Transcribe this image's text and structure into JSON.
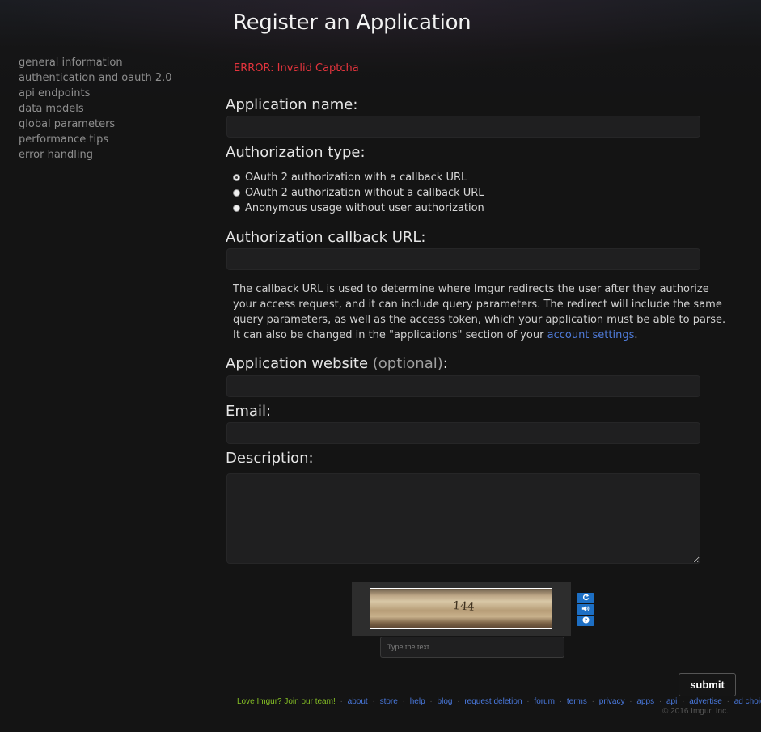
{
  "page": {
    "title": "Register an Application",
    "error": "ERROR: Invalid Captcha"
  },
  "sidebar": {
    "items": [
      {
        "label": "general information"
      },
      {
        "label": "authentication and oauth 2.0"
      },
      {
        "label": "api endpoints"
      },
      {
        "label": "data models"
      },
      {
        "label": "global parameters"
      },
      {
        "label": "performance tips"
      },
      {
        "label": "error handling"
      }
    ]
  },
  "form": {
    "app_name_label": "Application name:",
    "app_name_value": "",
    "auth_type_label": "Authorization type:",
    "auth_options": [
      {
        "label": "OAuth 2 authorization with a callback URL",
        "checked": true
      },
      {
        "label": "OAuth 2 authorization without a callback URL",
        "checked": false
      },
      {
        "label": "Anonymous usage without user authorization",
        "checked": false
      }
    ],
    "callback_label": "Authorization callback URL:",
    "callback_value": "",
    "callback_help_text": "The callback URL is used to determine where Imgur redirects the user after they authorize your access request, and it can include query parameters. The redirect will include the same query parameters, as well as the access token, which your application must be able to parse. It can also be changed in the \"applications\" section of your ",
    "callback_help_link": "account settings",
    "callback_help_end": ".",
    "website_label": "Application website",
    "website_optional": "(optional)",
    "website_colon": ":",
    "website_value": "",
    "email_label": "Email:",
    "email_value": "",
    "description_label": "Description:",
    "description_value": ""
  },
  "captcha": {
    "image_text": "144",
    "refresh_icon": "refresh-icon",
    "audio_icon": "speaker-icon",
    "help_icon": "question-icon",
    "input_placeholder": "Type the text",
    "submit_label": "submit"
  },
  "footer": {
    "love": "Love Imgur? Join our team!",
    "links": [
      "about",
      "store",
      "help",
      "blog",
      "request deletion",
      "forum",
      "terms",
      "privacy",
      "apps",
      "api",
      "advertise",
      "ad choices"
    ],
    "separator": "·",
    "copyright": "© 2016 Imgur, Inc."
  },
  "colors": {
    "background": "#141414",
    "error": "#e5343d",
    "link": "#4f7bd9",
    "footer_green": "#85bf25",
    "captcha_button": "#1d6fc4"
  }
}
